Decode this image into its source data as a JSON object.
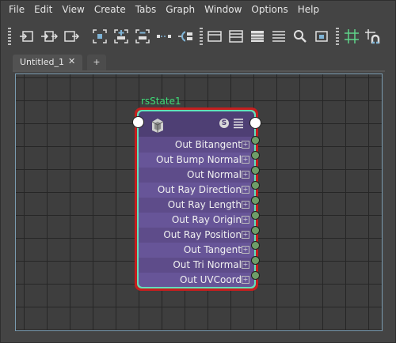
{
  "menu": [
    "File",
    "Edit",
    "View",
    "Create",
    "Tabs",
    "Graph",
    "Window",
    "Options",
    "Help"
  ],
  "toolbar": {
    "buttons": [
      "input-connections-icon",
      "input-output-connections-icon",
      "output-connections-icon",
      "frame-all-icon",
      "add-selected-icon",
      "remove-selected-icon",
      "graph-layout-icon",
      "clear-graph-icon",
      "view-simple-icon",
      "view-connected-icon",
      "view-full-icon",
      "view-custom-icon",
      "search-icon",
      "map-view-icon",
      "toggle-grid-icon",
      "snap-to-grid-icon"
    ]
  },
  "tabs": [
    {
      "label": "Untitled_1",
      "close": "✕"
    }
  ],
  "tab_add": "+",
  "node": {
    "title": "rsState1",
    "swatch_label": "S",
    "attributes": [
      "Out Bitangent",
      "Out Bump Normal",
      "Out Normal",
      "Out Ray Direction",
      "Out Ray Length",
      "Out Ray Origin",
      "Out Ray Position",
      "Out Tangent",
      "Out Tri Normal",
      "Out UVCoord"
    ]
  },
  "colors": {
    "node_body": "#5e4c8a",
    "node_selected_outline": "#c41f1f",
    "node_title": "#3fdc78",
    "output_port": "#6f9c68"
  }
}
